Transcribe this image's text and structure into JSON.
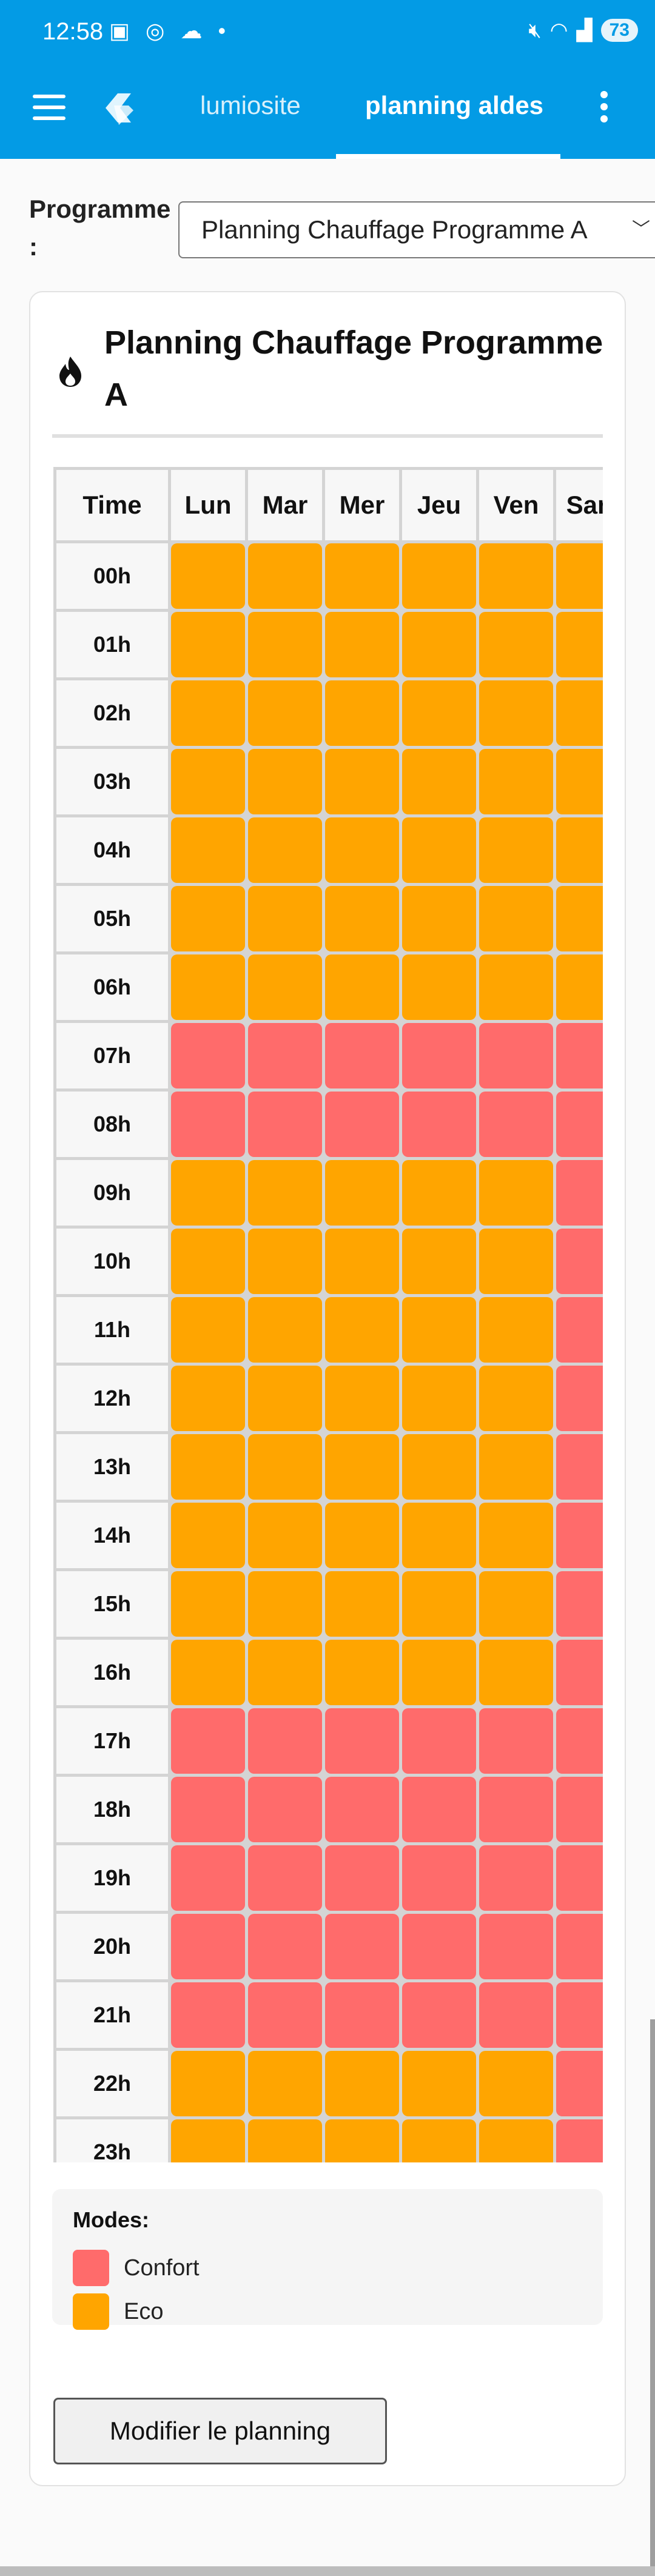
{
  "status_bar": {
    "time": "12:58",
    "icons": [
      "screenshot-icon",
      "whatsapp-icon",
      "cloud-icon",
      "dot-icon"
    ],
    "right_icons": [
      "mute-icon",
      "wifi-icon",
      "signal-icon"
    ],
    "battery": "73"
  },
  "app_bar": {
    "tabs": [
      {
        "label": "lumiosite"
      },
      {
        "label": "planning aldes"
      }
    ],
    "active_tab": "planning aldes"
  },
  "programme": {
    "label": "Programme\n:",
    "selected": "Planning Chauffage Programme A"
  },
  "card": {
    "title": "Planning Chauffage Programme A",
    "headers": [
      "Time",
      "Lun",
      "Mar",
      "Mer",
      "Jeu",
      "Ven",
      "Sam"
    ],
    "rows": [
      {
        "time": "00h",
        "modes": [
          "eco",
          "eco",
          "eco",
          "eco",
          "eco",
          "eco"
        ]
      },
      {
        "time": "01h",
        "modes": [
          "eco",
          "eco",
          "eco",
          "eco",
          "eco",
          "eco"
        ]
      },
      {
        "time": "02h",
        "modes": [
          "eco",
          "eco",
          "eco",
          "eco",
          "eco",
          "eco"
        ]
      },
      {
        "time": "03h",
        "modes": [
          "eco",
          "eco",
          "eco",
          "eco",
          "eco",
          "eco"
        ]
      },
      {
        "time": "04h",
        "modes": [
          "eco",
          "eco",
          "eco",
          "eco",
          "eco",
          "eco"
        ]
      },
      {
        "time": "05h",
        "modes": [
          "eco",
          "eco",
          "eco",
          "eco",
          "eco",
          "eco"
        ]
      },
      {
        "time": "06h",
        "modes": [
          "eco",
          "eco",
          "eco",
          "eco",
          "eco",
          "eco"
        ]
      },
      {
        "time": "07h",
        "modes": [
          "confort",
          "confort",
          "confort",
          "confort",
          "confort",
          "confort"
        ]
      },
      {
        "time": "08h",
        "modes": [
          "confort",
          "confort",
          "confort",
          "confort",
          "confort",
          "confort"
        ]
      },
      {
        "time": "09h",
        "modes": [
          "eco",
          "eco",
          "eco",
          "eco",
          "eco",
          "confort"
        ]
      },
      {
        "time": "10h",
        "modes": [
          "eco",
          "eco",
          "eco",
          "eco",
          "eco",
          "confort"
        ]
      },
      {
        "time": "11h",
        "modes": [
          "eco",
          "eco",
          "eco",
          "eco",
          "eco",
          "confort"
        ]
      },
      {
        "time": "12h",
        "modes": [
          "eco",
          "eco",
          "eco",
          "eco",
          "eco",
          "confort"
        ]
      },
      {
        "time": "13h",
        "modes": [
          "eco",
          "eco",
          "eco",
          "eco",
          "eco",
          "confort"
        ]
      },
      {
        "time": "14h",
        "modes": [
          "eco",
          "eco",
          "eco",
          "eco",
          "eco",
          "confort"
        ]
      },
      {
        "time": "15h",
        "modes": [
          "eco",
          "eco",
          "eco",
          "eco",
          "eco",
          "confort"
        ]
      },
      {
        "time": "16h",
        "modes": [
          "eco",
          "eco",
          "eco",
          "eco",
          "eco",
          "confort"
        ]
      },
      {
        "time": "17h",
        "modes": [
          "confort",
          "confort",
          "confort",
          "confort",
          "confort",
          "confort"
        ]
      },
      {
        "time": "18h",
        "modes": [
          "confort",
          "confort",
          "confort",
          "confort",
          "confort",
          "confort"
        ]
      },
      {
        "time": "19h",
        "modes": [
          "confort",
          "confort",
          "confort",
          "confort",
          "confort",
          "confort"
        ]
      },
      {
        "time": "20h",
        "modes": [
          "confort",
          "confort",
          "confort",
          "confort",
          "confort",
          "confort"
        ]
      },
      {
        "time": "21h",
        "modes": [
          "confort",
          "confort",
          "confort",
          "confort",
          "confort",
          "confort"
        ]
      },
      {
        "time": "22h",
        "modes": [
          "eco",
          "eco",
          "eco",
          "eco",
          "eco",
          "confort"
        ]
      },
      {
        "time": "23h",
        "modes": [
          "eco",
          "eco",
          "eco",
          "eco",
          "eco",
          "confort"
        ]
      }
    ]
  },
  "legend": {
    "title": "Modes:",
    "items": [
      {
        "label": "Confort",
        "color": "#ff6b6b"
      },
      {
        "label": "Eco",
        "color": "#ffa500"
      }
    ]
  },
  "edit_button": {
    "label": "Modifier le planning"
  },
  "colors": {
    "app_bar": "#039be5",
    "confort": "#ff6b6b",
    "eco": "#ffa500"
  }
}
